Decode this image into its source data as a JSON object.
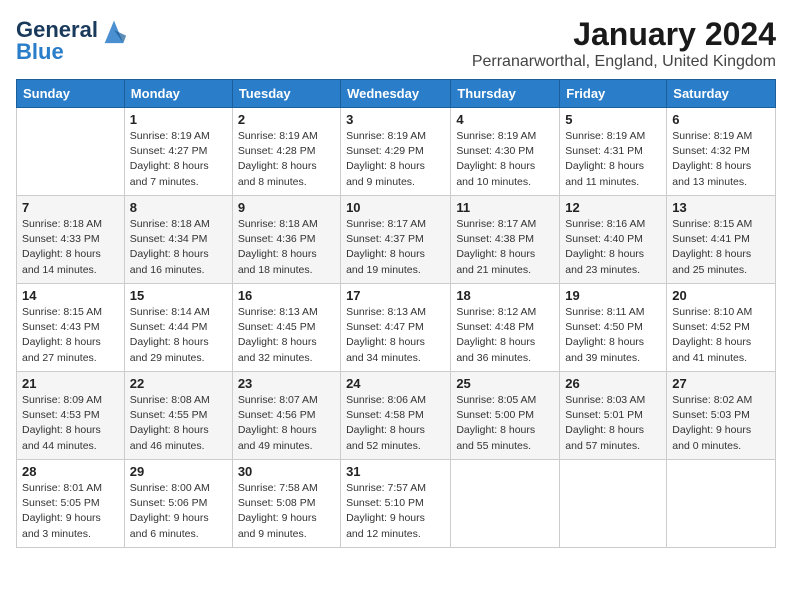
{
  "logo": {
    "line1": "General",
    "line2": "Blue"
  },
  "title": "January 2024",
  "subtitle": "Perranarworthal, England, United Kingdom",
  "weekdays": [
    "Sunday",
    "Monday",
    "Tuesday",
    "Wednesday",
    "Thursday",
    "Friday",
    "Saturday"
  ],
  "weeks": [
    [
      {
        "day": "",
        "info": ""
      },
      {
        "day": "1",
        "info": "Sunrise: 8:19 AM\nSunset: 4:27 PM\nDaylight: 8 hours\nand 7 minutes."
      },
      {
        "day": "2",
        "info": "Sunrise: 8:19 AM\nSunset: 4:28 PM\nDaylight: 8 hours\nand 8 minutes."
      },
      {
        "day": "3",
        "info": "Sunrise: 8:19 AM\nSunset: 4:29 PM\nDaylight: 8 hours\nand 9 minutes."
      },
      {
        "day": "4",
        "info": "Sunrise: 8:19 AM\nSunset: 4:30 PM\nDaylight: 8 hours\nand 10 minutes."
      },
      {
        "day": "5",
        "info": "Sunrise: 8:19 AM\nSunset: 4:31 PM\nDaylight: 8 hours\nand 11 minutes."
      },
      {
        "day": "6",
        "info": "Sunrise: 8:19 AM\nSunset: 4:32 PM\nDaylight: 8 hours\nand 13 minutes."
      }
    ],
    [
      {
        "day": "7",
        "info": "Sunrise: 8:18 AM\nSunset: 4:33 PM\nDaylight: 8 hours\nand 14 minutes."
      },
      {
        "day": "8",
        "info": "Sunrise: 8:18 AM\nSunset: 4:34 PM\nDaylight: 8 hours\nand 16 minutes."
      },
      {
        "day": "9",
        "info": "Sunrise: 8:18 AM\nSunset: 4:36 PM\nDaylight: 8 hours\nand 18 minutes."
      },
      {
        "day": "10",
        "info": "Sunrise: 8:17 AM\nSunset: 4:37 PM\nDaylight: 8 hours\nand 19 minutes."
      },
      {
        "day": "11",
        "info": "Sunrise: 8:17 AM\nSunset: 4:38 PM\nDaylight: 8 hours\nand 21 minutes."
      },
      {
        "day": "12",
        "info": "Sunrise: 8:16 AM\nSunset: 4:40 PM\nDaylight: 8 hours\nand 23 minutes."
      },
      {
        "day": "13",
        "info": "Sunrise: 8:15 AM\nSunset: 4:41 PM\nDaylight: 8 hours\nand 25 minutes."
      }
    ],
    [
      {
        "day": "14",
        "info": "Sunrise: 8:15 AM\nSunset: 4:43 PM\nDaylight: 8 hours\nand 27 minutes."
      },
      {
        "day": "15",
        "info": "Sunrise: 8:14 AM\nSunset: 4:44 PM\nDaylight: 8 hours\nand 29 minutes."
      },
      {
        "day": "16",
        "info": "Sunrise: 8:13 AM\nSunset: 4:45 PM\nDaylight: 8 hours\nand 32 minutes."
      },
      {
        "day": "17",
        "info": "Sunrise: 8:13 AM\nSunset: 4:47 PM\nDaylight: 8 hours\nand 34 minutes."
      },
      {
        "day": "18",
        "info": "Sunrise: 8:12 AM\nSunset: 4:48 PM\nDaylight: 8 hours\nand 36 minutes."
      },
      {
        "day": "19",
        "info": "Sunrise: 8:11 AM\nSunset: 4:50 PM\nDaylight: 8 hours\nand 39 minutes."
      },
      {
        "day": "20",
        "info": "Sunrise: 8:10 AM\nSunset: 4:52 PM\nDaylight: 8 hours\nand 41 minutes."
      }
    ],
    [
      {
        "day": "21",
        "info": "Sunrise: 8:09 AM\nSunset: 4:53 PM\nDaylight: 8 hours\nand 44 minutes."
      },
      {
        "day": "22",
        "info": "Sunrise: 8:08 AM\nSunset: 4:55 PM\nDaylight: 8 hours\nand 46 minutes."
      },
      {
        "day": "23",
        "info": "Sunrise: 8:07 AM\nSunset: 4:56 PM\nDaylight: 8 hours\nand 49 minutes."
      },
      {
        "day": "24",
        "info": "Sunrise: 8:06 AM\nSunset: 4:58 PM\nDaylight: 8 hours\nand 52 minutes."
      },
      {
        "day": "25",
        "info": "Sunrise: 8:05 AM\nSunset: 5:00 PM\nDaylight: 8 hours\nand 55 minutes."
      },
      {
        "day": "26",
        "info": "Sunrise: 8:03 AM\nSunset: 5:01 PM\nDaylight: 8 hours\nand 57 minutes."
      },
      {
        "day": "27",
        "info": "Sunrise: 8:02 AM\nSunset: 5:03 PM\nDaylight: 9 hours\nand 0 minutes."
      }
    ],
    [
      {
        "day": "28",
        "info": "Sunrise: 8:01 AM\nSunset: 5:05 PM\nDaylight: 9 hours\nand 3 minutes."
      },
      {
        "day": "29",
        "info": "Sunrise: 8:00 AM\nSunset: 5:06 PM\nDaylight: 9 hours\nand 6 minutes."
      },
      {
        "day": "30",
        "info": "Sunrise: 7:58 AM\nSunset: 5:08 PM\nDaylight: 9 hours\nand 9 minutes."
      },
      {
        "day": "31",
        "info": "Sunrise: 7:57 AM\nSunset: 5:10 PM\nDaylight: 9 hours\nand 12 minutes."
      },
      {
        "day": "",
        "info": ""
      },
      {
        "day": "",
        "info": ""
      },
      {
        "day": "",
        "info": ""
      }
    ]
  ]
}
